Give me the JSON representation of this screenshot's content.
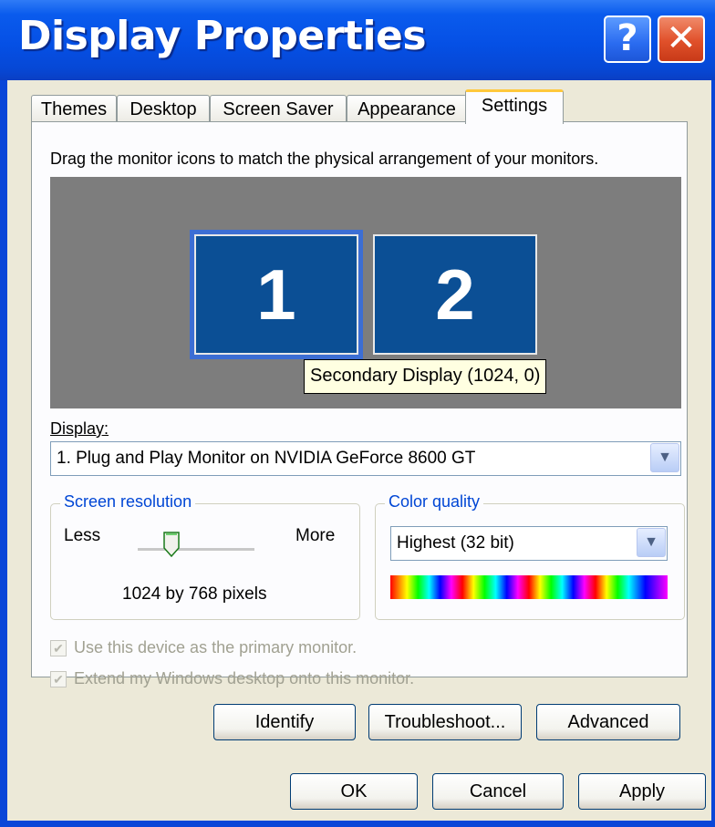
{
  "window": {
    "title": "Display Properties",
    "help_icon": "help-icon",
    "close_icon": "close-icon"
  },
  "tabs": [
    {
      "label": "Themes"
    },
    {
      "label": "Desktop"
    },
    {
      "label": "Screen Saver"
    },
    {
      "label": "Appearance"
    },
    {
      "label": "Settings",
      "active": true
    }
  ],
  "settings": {
    "instruction": "Drag the monitor icons to match the physical arrangement of your monitors.",
    "monitors": [
      "1",
      "2"
    ],
    "tooltip": "Secondary Display (1024, 0)",
    "display_label": "Display:",
    "display_value": "1. Plug and Play Monitor on NVIDIA GeForce 8600 GT",
    "resolution": {
      "title": "Screen resolution",
      "less": "Less",
      "more": "More",
      "value": "1024 by 768 pixels"
    },
    "color_quality": {
      "title": "Color quality",
      "value": "Highest (32 bit)"
    },
    "checkboxes": [
      {
        "label": "Use this device as the primary monitor.",
        "checked": true,
        "enabled": false
      },
      {
        "label": "Extend my Windows desktop onto this monitor.",
        "checked": true,
        "enabled": false
      }
    ],
    "buttons": {
      "identify": "Identify",
      "troubleshoot": "Troubleshoot...",
      "advanced": "Advanced"
    }
  },
  "dialog_buttons": {
    "ok": "OK",
    "cancel": "Cancel",
    "apply": "Apply"
  },
  "colors": {
    "title_bar": "#0550e5",
    "monitor_fill": "#0b4f95",
    "group_title": "#0046d5"
  }
}
